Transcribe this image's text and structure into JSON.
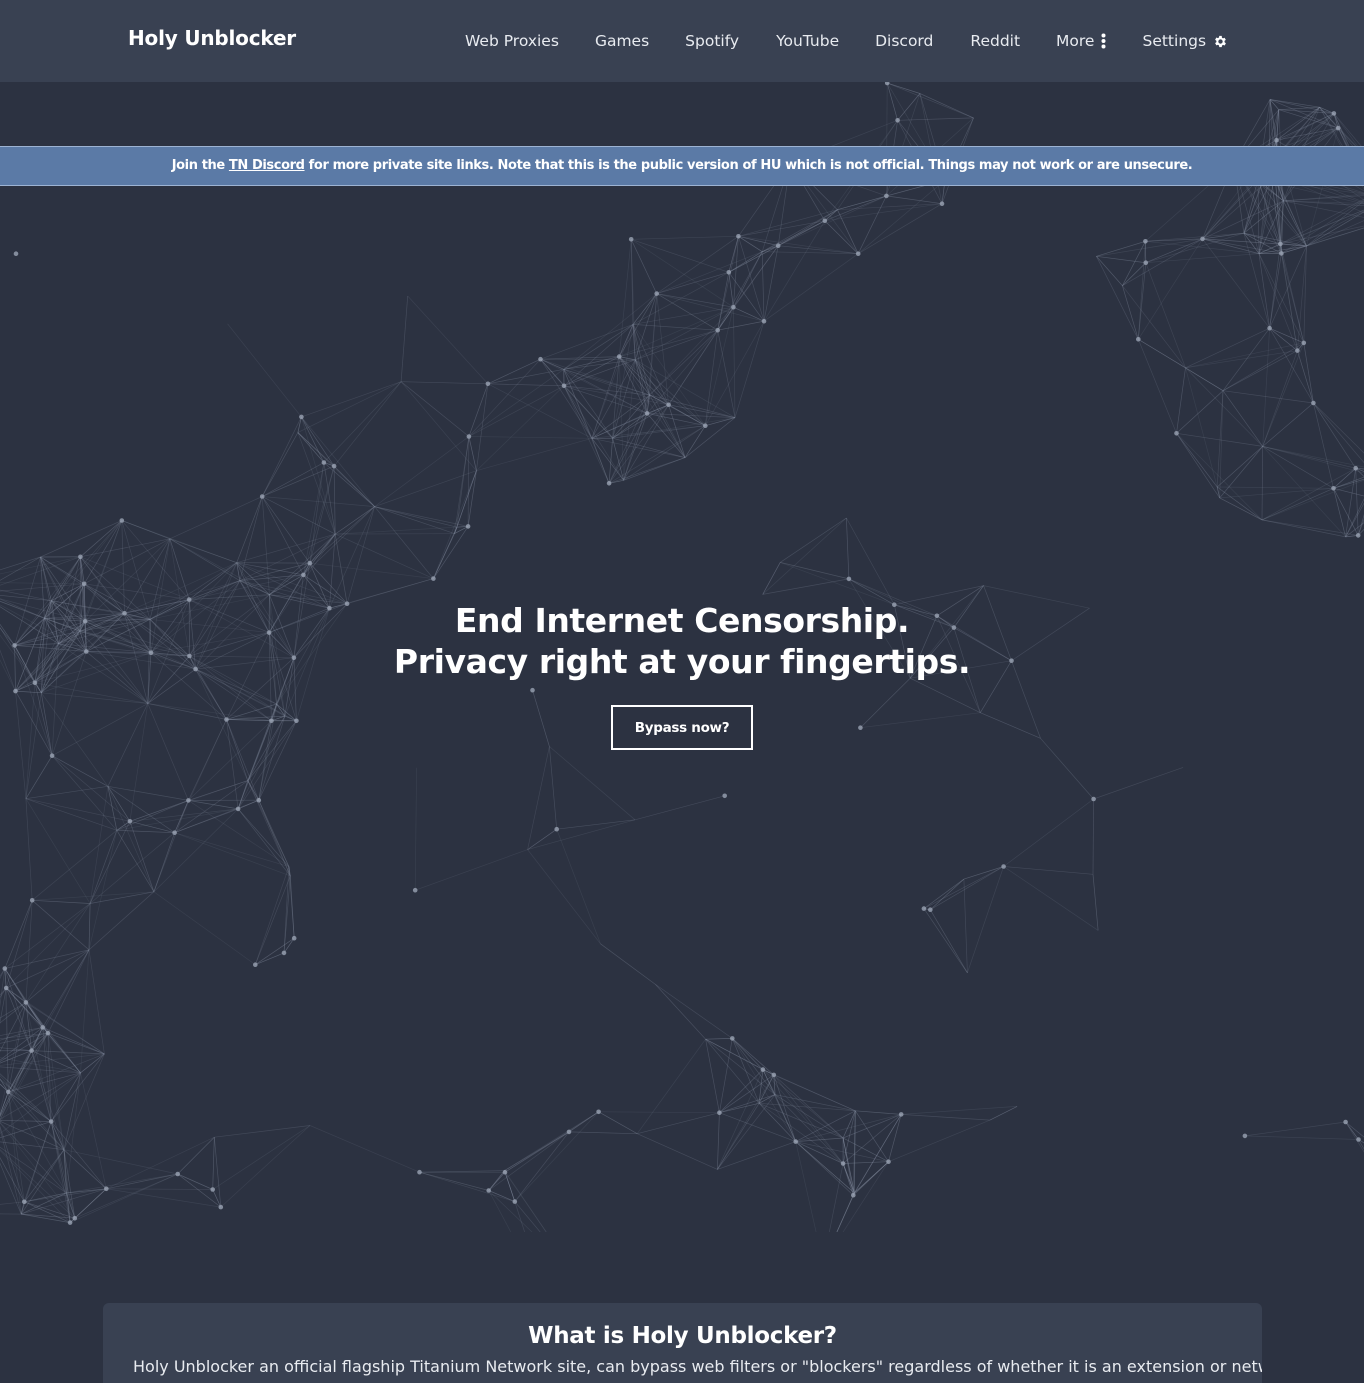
{
  "nav": {
    "brand": "Holy Unblocker",
    "links": [
      {
        "label": "Web Proxies"
      },
      {
        "label": "Games"
      },
      {
        "label": "Spotify"
      },
      {
        "label": "YouTube"
      },
      {
        "label": "Discord"
      },
      {
        "label": "Reddit"
      },
      {
        "label": "More",
        "icon": "vertical-ellipsis-icon"
      },
      {
        "label": "Settings",
        "icon": "gear-icon"
      }
    ]
  },
  "banner": {
    "prefix": "Join the ",
    "link": "TN Discord",
    "suffix": " for more private site links. Note that this is the public version of HU which is not official. Things may not work or are unsecure."
  },
  "hero": {
    "line1": "End Internet Censorship.",
    "line2": "Privacy right at your fingertips.",
    "button": "Bypass now?"
  },
  "info": {
    "title": "What is Holy Unblocker?",
    "text": "Holy Unblocker an official flagship Titanium Network site, can bypass web filters or \"blockers\" regardless of whether it is an extension or network"
  },
  "colors": {
    "navbar": "#394152",
    "background": "#2c3241",
    "banner": "#5b7aa6",
    "network_lines": "#8a93a6",
    "network_nodes": "#9aa2b3"
  }
}
